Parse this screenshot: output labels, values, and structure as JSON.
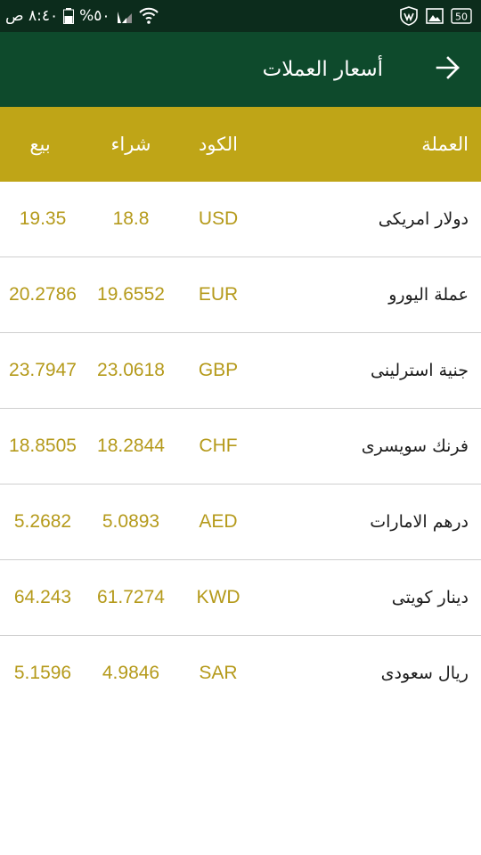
{
  "status_bar": {
    "time": "٨:٤٠ ص",
    "battery_percent": "%٥٠",
    "icons": [
      "wifi-icon",
      "signal-icon",
      "battery-icon",
      "badge-50-icon",
      "image-icon",
      "shield-icon"
    ]
  },
  "app_bar": {
    "title": "أسعار العملات",
    "back_icon": "arrow-right-icon",
    "color": "#0e4a2c"
  },
  "table": {
    "header_color": "#bfa517",
    "value_color": "#b59a1b",
    "headers": {
      "currency": "العملة",
      "code": "الكود",
      "buy": "شراء",
      "sell": "بيع"
    },
    "rows": [
      {
        "name": "دولار امريكى",
        "code": "USD",
        "buy": "18.8",
        "sell": "19.35"
      },
      {
        "name": "عملة اليورو",
        "code": "EUR",
        "buy": "19.6552",
        "sell": "20.2786"
      },
      {
        "name": "جنية استرلينى",
        "code": "GBP",
        "buy": "23.0618",
        "sell": "23.7947"
      },
      {
        "name": "فرنك سويسرى",
        "code": "CHF",
        "buy": "18.2844",
        "sell": "18.8505"
      },
      {
        "name": "درهم الامارات",
        "code": "AED",
        "buy": "5.0893",
        "sell": "5.2682"
      },
      {
        "name": "دينار كويتى",
        "code": "KWD",
        "buy": "61.7274",
        "sell": "64.243"
      },
      {
        "name": "ريال سعودى",
        "code": "SAR",
        "buy": "4.9846",
        "sell": "5.1596"
      }
    ]
  }
}
